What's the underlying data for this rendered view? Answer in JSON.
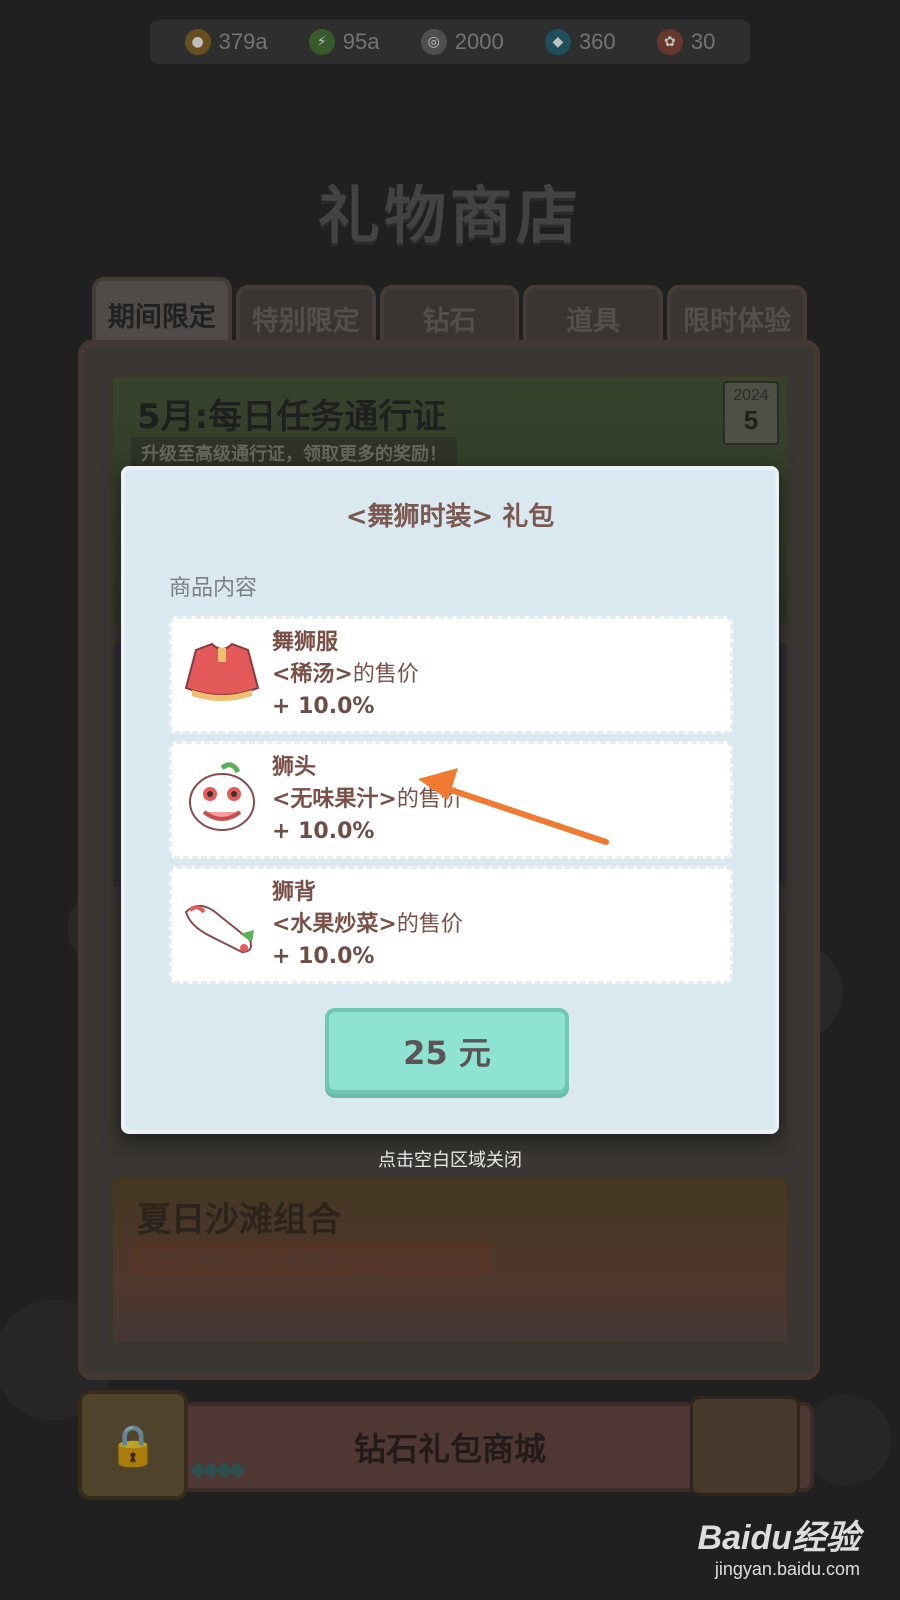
{
  "currencies": [
    {
      "icon": "gold-coin-icon",
      "value": "379a",
      "color": "#8a6a2a"
    },
    {
      "icon": "energy-bolt-icon",
      "value": "95a",
      "color": "#4a7a3a"
    },
    {
      "icon": "silver-coin-icon",
      "value": "2000",
      "color": "#6a6a6a"
    },
    {
      "icon": "diamond-icon",
      "value": "360",
      "color": "#2a6a7a"
    },
    {
      "icon": "ticket-icon",
      "value": "30",
      "color": "#8a4a3a"
    }
  ],
  "shop_title": "礼物商店",
  "tabs": [
    "期间限定",
    "特别限定",
    "钻石",
    "道具",
    "限时体验"
  ],
  "active_tab": "期间限定",
  "banners": {
    "pass": {
      "title": "5月:每日任务通行证",
      "subtitle": "升级至高级通行证，领取更多的奖励！",
      "calendar_year": "2024",
      "calendar_day": "5"
    },
    "beach": {
      "title": "夏日沙滩组合",
      "subtitle": "夏天沙滩游玩的时尚套装"
    }
  },
  "diamond_shop_label": "钻石礼包商城",
  "modal": {
    "title": "<舞狮时装> 礼包",
    "section_label": "商品内容",
    "items": [
      {
        "name": "舞狮服",
        "dish": "<稀汤>",
        "suffix": "的售价",
        "bonus": "+ 10.0%",
        "icon": "lion-costume-icon"
      },
      {
        "name": "狮头",
        "dish": "<无味果汁>",
        "suffix": "的售价",
        "bonus": "+ 10.0%",
        "icon": "lion-head-icon"
      },
      {
        "name": "狮背",
        "dish": "<水果炒菜>",
        "suffix": "的售价",
        "bonus": "+ 10.0%",
        "icon": "lion-back-icon"
      }
    ],
    "price": "25 元",
    "close_hint": "点击空白区域关闭"
  },
  "watermark": {
    "brand": "Baidu经验",
    "url": "jingyan.baidu.com"
  }
}
